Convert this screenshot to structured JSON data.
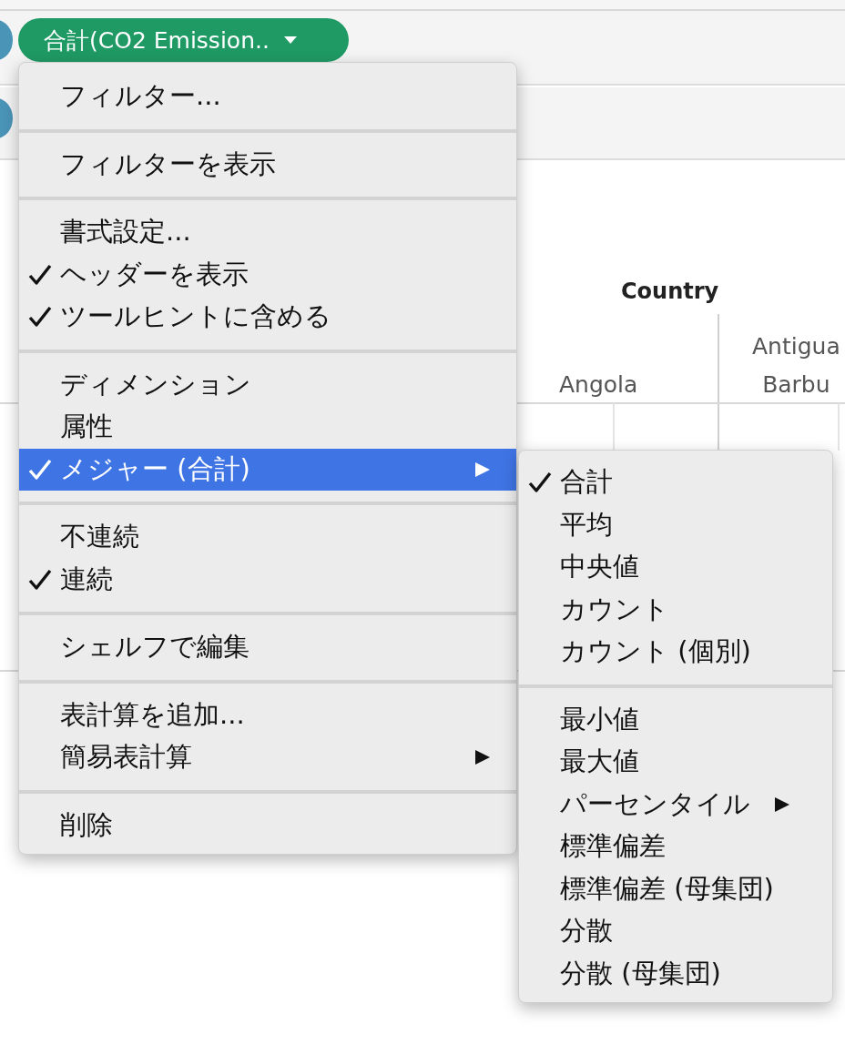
{
  "pill": {
    "label": "合計(CO2 Emission.."
  },
  "table": {
    "header": "Country",
    "columns": [
      {
        "lines": [
          "Angola"
        ]
      },
      {
        "lines": [
          "Antigua",
          "Barbu"
        ]
      }
    ]
  },
  "menu": {
    "groups": [
      [
        {
          "label": "フィルター...",
          "checked": false,
          "selected": false,
          "submenu": false
        }
      ],
      [
        {
          "label": "フィルターを表示",
          "checked": false,
          "selected": false,
          "submenu": false
        }
      ],
      [
        {
          "label": "書式設定...",
          "checked": false,
          "selected": false,
          "submenu": false
        },
        {
          "label": "ヘッダーを表示",
          "checked": true,
          "selected": false,
          "submenu": false
        },
        {
          "label": "ツールヒントに含める",
          "checked": true,
          "selected": false,
          "submenu": false
        }
      ],
      [
        {
          "label": "ディメンション",
          "checked": false,
          "selected": false,
          "submenu": false
        },
        {
          "label": "属性",
          "checked": false,
          "selected": false,
          "submenu": false
        },
        {
          "label": "メジャー (合計)",
          "checked": true,
          "selected": true,
          "submenu": true
        }
      ],
      [
        {
          "label": "不連続",
          "checked": false,
          "selected": false,
          "submenu": false
        },
        {
          "label": "連続",
          "checked": true,
          "selected": false,
          "submenu": false
        }
      ],
      [
        {
          "label": "シェルフで編集",
          "checked": false,
          "selected": false,
          "submenu": false
        }
      ],
      [
        {
          "label": "表計算を追加...",
          "checked": false,
          "selected": false,
          "submenu": false
        },
        {
          "label": "簡易表計算",
          "checked": false,
          "selected": false,
          "submenu": true
        }
      ],
      [
        {
          "label": "削除",
          "checked": false,
          "selected": false,
          "submenu": false
        }
      ]
    ]
  },
  "submenu": {
    "groups": [
      [
        {
          "label": "合計",
          "checked": true,
          "selected": false,
          "submenu": false
        },
        {
          "label": "平均",
          "checked": false,
          "selected": false,
          "submenu": false
        },
        {
          "label": "中央値",
          "checked": false,
          "selected": false,
          "submenu": false
        },
        {
          "label": "カウント",
          "checked": false,
          "selected": false,
          "submenu": false
        },
        {
          "label": "カウント (個別)",
          "checked": false,
          "selected": false,
          "submenu": false
        }
      ],
      [
        {
          "label": "最小値",
          "checked": false,
          "selected": false,
          "submenu": false
        },
        {
          "label": "最大値",
          "checked": false,
          "selected": false,
          "submenu": false
        },
        {
          "label": "パーセンタイル",
          "checked": false,
          "selected": false,
          "submenu": true
        },
        {
          "label": "標準偏差",
          "checked": false,
          "selected": false,
          "submenu": false
        },
        {
          "label": "標準偏差 (母集団)",
          "checked": false,
          "selected": false,
          "submenu": false
        },
        {
          "label": "分散",
          "checked": false,
          "selected": false,
          "submenu": false
        },
        {
          "label": "分散 (母集団)",
          "checked": false,
          "selected": false,
          "submenu": false
        }
      ]
    ]
  }
}
